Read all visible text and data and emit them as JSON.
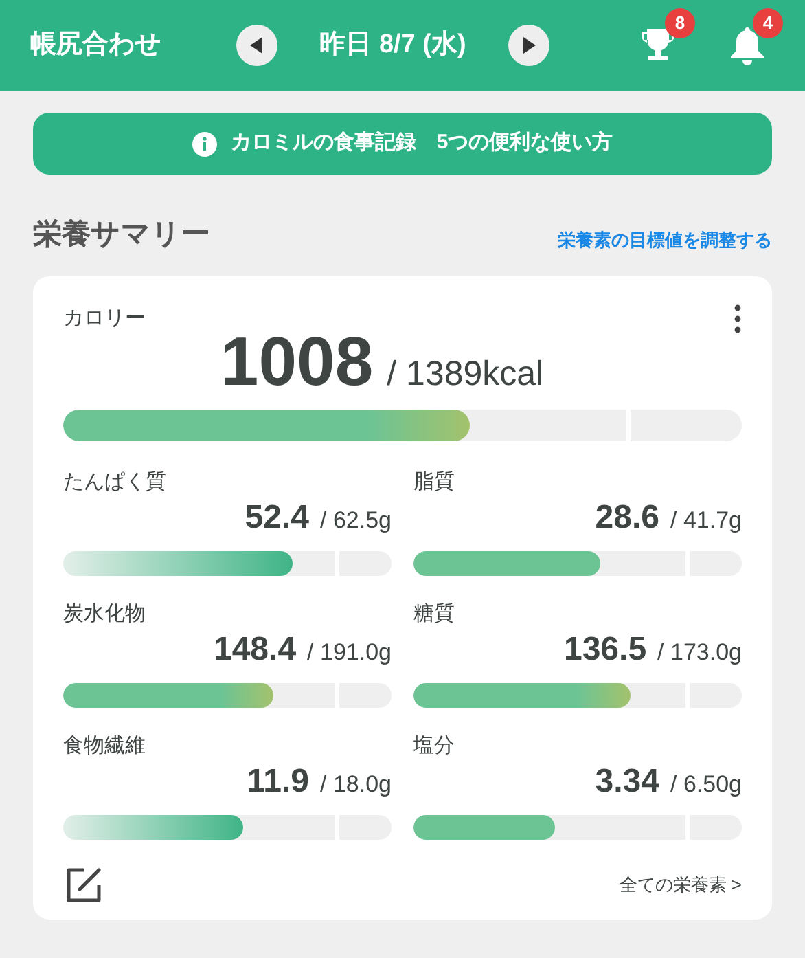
{
  "header": {
    "title": "帳尻合わせ",
    "date": "昨日 8/7 (水)",
    "trophy_badge": "8",
    "bell_badge": "4"
  },
  "banner": {
    "text": "カロミルの食事記録　5つの便利な使い方"
  },
  "section": {
    "title": "栄養サマリー",
    "link": "栄養素の目標値を調整する"
  },
  "calorie": {
    "label": "カロリー",
    "value": "1008",
    "target": "/ 1389kcal",
    "level": 0.6,
    "kind": "warm"
  },
  "nutrients": [
    {
      "label": "たんぱく質",
      "value": "52.4",
      "target": "/ 62.5g",
      "level": 0.7,
      "kind": "fade"
    },
    {
      "label": "脂質",
      "value": "28.6",
      "target": "/ 41.7g",
      "level": 0.57,
      "kind": "solid"
    },
    {
      "label": "炭水化物",
      "value": "148.4",
      "target": "/ 191.0g",
      "level": 0.64,
      "kind": "warm"
    },
    {
      "label": "糖質",
      "value": "136.5",
      "target": "/ 173.0g",
      "level": 0.66,
      "kind": "warm"
    },
    {
      "label": "食物繊維",
      "value": "11.9",
      "target": "/ 18.0g",
      "level": 0.55,
      "kind": "fade"
    },
    {
      "label": "塩分",
      "value": "3.34",
      "target": "/ 6.50g",
      "level": 0.43,
      "kind": "solid"
    }
  ],
  "footer": {
    "link": "全ての栄養素 >"
  }
}
